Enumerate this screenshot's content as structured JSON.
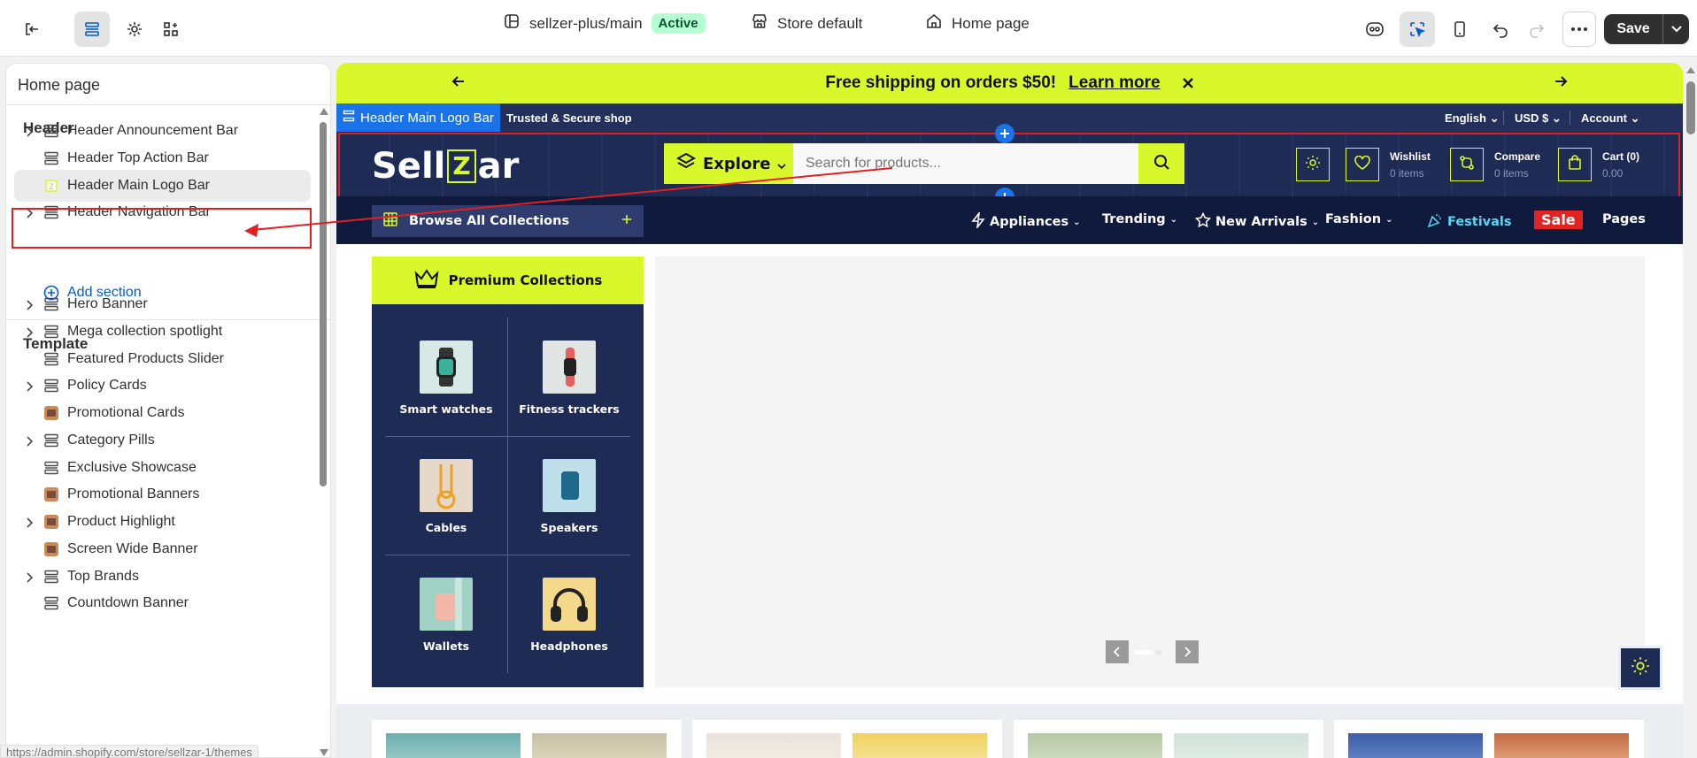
{
  "topbar": {
    "store_path": "sellzer-plus/main",
    "status_badge": "Active",
    "store_default": "Store default",
    "page_select": "Home page",
    "save_label": "Save",
    "colors": {
      "badge_bg": "#b4fed2",
      "save_bg": "#303030",
      "accent": "#005bd3"
    }
  },
  "sidebar": {
    "title": "Home page",
    "header_group": "Header",
    "header_sections": [
      {
        "label": "Header Announcement Bar",
        "expandable": true,
        "icon": "section-icon"
      },
      {
        "label": "Header Top Action Bar",
        "expandable": false,
        "icon": "section-icon"
      },
      {
        "label": "Header Main Logo Bar",
        "expandable": false,
        "icon": "logo-thumb-icon",
        "selected": true
      },
      {
        "label": "Header Navigation Bar",
        "expandable": true,
        "icon": "section-icon"
      }
    ],
    "add_section": "Add section",
    "template_group": "Template",
    "template_sections": [
      {
        "label": "Hero Banner",
        "expandable": true,
        "icon": "section-icon"
      },
      {
        "label": "Mega collection spotlight",
        "expandable": true,
        "icon": "section-icon"
      },
      {
        "label": "Featured Products Slider",
        "expandable": false,
        "icon": "section-icon"
      },
      {
        "label": "Policy Cards",
        "expandable": true,
        "icon": "section-icon"
      },
      {
        "label": "Promotional Cards",
        "expandable": false,
        "icon": "image-thumb-icon"
      },
      {
        "label": "Category Pills",
        "expandable": true,
        "icon": "section-icon"
      },
      {
        "label": "Exclusive Showcase",
        "expandable": false,
        "icon": "section-icon"
      },
      {
        "label": "Promotional Banners",
        "expandable": false,
        "icon": "image-thumb-icon"
      },
      {
        "label": "Product Highlight",
        "expandable": true,
        "icon": "image-thumb-icon"
      },
      {
        "label": "Screen Wide Banner",
        "expandable": false,
        "icon": "image-thumb-icon"
      },
      {
        "label": "Top Brands",
        "expandable": true,
        "icon": "section-icon"
      },
      {
        "label": "Countdown Banner",
        "expandable": false,
        "icon": "section-icon"
      }
    ],
    "status_url": "https://admin.shopify.com/store/sellzar-1/themes"
  },
  "preview": {
    "announcement": {
      "text": "Free shipping on orders $50!",
      "link": "Learn more"
    },
    "selected_tag": "Header Main Logo Bar",
    "top_action": {
      "tagline": "Trusted & Secure shop",
      "language": "English",
      "currency": "USD $",
      "account": "Account"
    },
    "logo": {
      "left": "Sell",
      "boxed": "Z",
      "right": "ar"
    },
    "explore": "Explore",
    "search_placeholder": "Search for products...",
    "wishlist": {
      "label": "Wishlist",
      "count": "0 items"
    },
    "compare": {
      "label": "Compare",
      "count": "0 items"
    },
    "cart": {
      "label": "Cart (0)",
      "total": "0.00"
    },
    "browse_all": "Browse All Collections",
    "nav": [
      "Appliances",
      "Trending",
      "New Arrivals",
      "Fashion",
      "Festivals",
      "Sale",
      "Pages"
    ],
    "premium": "Premium Collections",
    "collections": [
      "Smart watches",
      "Fitness trackers",
      "Cables",
      "Speakers",
      "Wallets",
      "Headphones"
    ],
    "colors": {
      "lime": "#d9f82c",
      "navy": "#1d2b55",
      "dark_navy": "#0f1a3c",
      "sale_red": "#e02424",
      "festivals": "#5ad8f5"
    }
  }
}
